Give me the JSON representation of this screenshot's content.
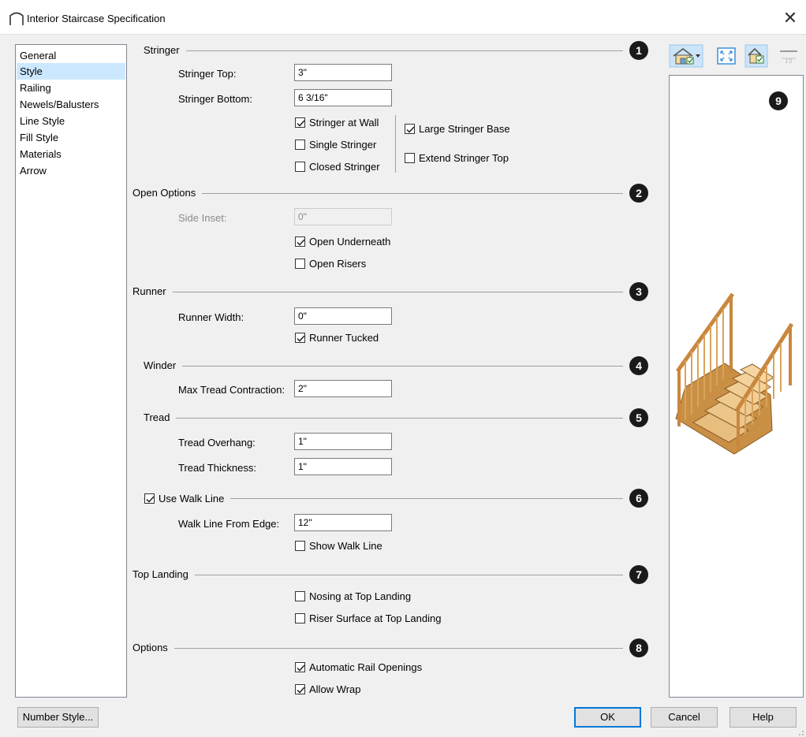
{
  "window": {
    "title": "Interior Staircase Specification",
    "close_glyph": "✕"
  },
  "categories": [
    {
      "label": "General",
      "selected": false
    },
    {
      "label": "Style",
      "selected": true
    },
    {
      "label": "Railing",
      "selected": false
    },
    {
      "label": "Newels/Balusters",
      "selected": false
    },
    {
      "label": "Line Style",
      "selected": false
    },
    {
      "label": "Fill Style",
      "selected": false
    },
    {
      "label": "Materials",
      "selected": false
    },
    {
      "label": "Arrow",
      "selected": false
    }
  ],
  "stringer": {
    "title": "Stringer",
    "badge": "1",
    "top_label": "Stringer Top:",
    "top_value": "3\"",
    "bottom_label": "Stringer Bottom:",
    "bottom_value": "6 3/16\"",
    "at_wall": {
      "label": "Stringer at Wall",
      "checked": true
    },
    "single": {
      "label": "Single Stringer",
      "checked": false
    },
    "closed": {
      "label": "Closed Stringer",
      "checked": false
    },
    "large_base": {
      "label": "Large Stringer Base",
      "checked": true
    },
    "extend_top": {
      "label": "Extend Stringer Top",
      "checked": false
    }
  },
  "open_options": {
    "title": "Open Options",
    "badge": "2",
    "side_inset_label": "Side Inset:",
    "side_inset_value": "0\"",
    "open_underneath": {
      "label": "Open Underneath",
      "checked": true
    },
    "open_risers": {
      "label": "Open Risers",
      "checked": false
    }
  },
  "runner": {
    "title": "Runner",
    "badge": "3",
    "width_label": "Runner Width:",
    "width_value": "0\"",
    "tucked": {
      "label": "Runner Tucked",
      "checked": true
    }
  },
  "winder": {
    "title": "Winder",
    "badge": "4",
    "max_label": "Max Tread Contraction:",
    "max_value": "2\""
  },
  "tread": {
    "title": "Tread",
    "badge": "5",
    "overhang_label": "Tread Overhang:",
    "overhang_value": "1\"",
    "thickness_label": "Tread Thickness:",
    "thickness_value": "1\""
  },
  "walk_line": {
    "use": {
      "label": "Use Walk Line",
      "checked": true
    },
    "badge": "6",
    "edge_label": "Walk Line From Edge:",
    "edge_value": "12\"",
    "show": {
      "label": "Show Walk Line",
      "checked": false
    }
  },
  "top_landing": {
    "title": "Top Landing",
    "badge": "7",
    "nosing": {
      "label": "Nosing at Top Landing",
      "checked": false
    },
    "riser": {
      "label": "Riser Surface at Top Landing",
      "checked": false
    }
  },
  "options": {
    "title": "Options",
    "badge": "8",
    "auto_rail": {
      "label": "Automatic Rail Openings",
      "checked": true
    },
    "allow_wrap": {
      "label": "Allow Wrap",
      "checked": true
    }
  },
  "preview": {
    "badge": "9",
    "tools": [
      "view-icon",
      "fit-window-icon",
      "show-materials-icon",
      "layer-display-icon"
    ]
  },
  "buttons": {
    "number_style": "Number Style...",
    "ok": "OK",
    "cancel": "Cancel",
    "help": "Help"
  },
  "colors": {
    "selection": "#cce8ff",
    "badge": "#1a1a1a",
    "default_button_border": "#0078d7",
    "wood": "#d9a35a"
  }
}
